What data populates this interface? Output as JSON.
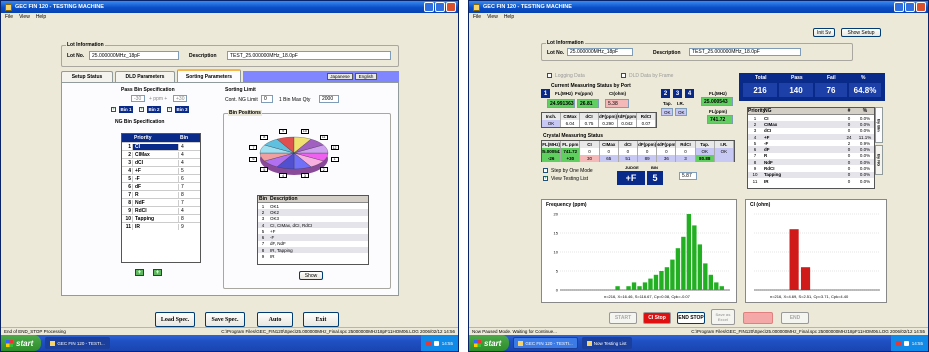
{
  "left": {
    "title": "GEC FIN 120 - TESTING MACHINE",
    "menu": [
      "File",
      "View",
      "Help"
    ],
    "lot": {
      "group_title": "Lot Information",
      "lotno_label": "Lot No.",
      "lotno_value": "25.000000MHz_18pF",
      "desc_label": "Description",
      "desc_value": "TEST_25.000000MHz_18.0pF"
    },
    "tabs": [
      "Setup Status",
      "DLD Parameters",
      "Sorting Parameters"
    ],
    "lang": [
      "Japanese",
      "English"
    ],
    "pass_bin": {
      "title": "Pass Bin Specification",
      "minus": "-30",
      "unit": "+ ppm +",
      "plus": "+30",
      "bins": [
        "Bin 1",
        "Bin 2",
        "Bin 3"
      ]
    },
    "ng_bin": {
      "title": "NG Bin Specification",
      "headers": [
        "Priority",
        "Bin"
      ],
      "rows": [
        [
          "1",
          "CI",
          "4"
        ],
        [
          "2",
          "CIMax",
          "4"
        ],
        [
          "3",
          "dCI",
          "4"
        ],
        [
          "4",
          "+F",
          "5"
        ],
        [
          "5",
          "-F",
          "6"
        ],
        [
          "6",
          "dF",
          "7"
        ],
        [
          "7",
          "R",
          "8"
        ],
        [
          "8",
          "NdF",
          "7"
        ],
        [
          "9",
          "RdCI",
          "4"
        ],
        [
          "10",
          "Tapping",
          "8"
        ],
        [
          "11",
          "IR",
          "9"
        ]
      ]
    },
    "sorting_limit": {
      "title": "Sorting Limit",
      "cont_label": "Cont. NG Limit",
      "cont_value": "0",
      "bin_label": "1 Bin Max Qty",
      "bin_value": "2000"
    },
    "bin_positions": {
      "title": "Bin Positions",
      "pie_labels": [
        "1",
        "2",
        "3",
        "4",
        "5",
        "6",
        "7",
        "8",
        "9",
        "10",
        "11",
        "12"
      ],
      "desc_headers": [
        "Bin",
        "Description"
      ],
      "desc_rows": [
        [
          "1",
          "OK1"
        ],
        [
          "2",
          "OK2"
        ],
        [
          "3",
          "OK3"
        ],
        [
          "4",
          "CI, CIMax, dCI, RdCI"
        ],
        [
          "5",
          "+F"
        ],
        [
          "6",
          "-F"
        ],
        [
          "7",
          "dF, NdF"
        ],
        [
          "8",
          "IR, Tapping"
        ],
        [
          "9",
          "IR"
        ]
      ],
      "show_btn": "Show"
    },
    "footer_buttons": [
      "Load Spec.",
      "Save Spec.",
      "Auto",
      "Exit"
    ],
    "status_left": "End of END_STOP Processing",
    "status_right": "C:\\Program Files\\GEC_FIN120\\Spec\\25.000000MHz_Final.spc  25000000MHz18pF11HOM06.LOG  2006/02/12  14:56",
    "task_item": "GEC FIN 120 - TESTI..."
  },
  "right": {
    "title": "GEC FIN 120 - TESTING MACHINE",
    "menu": [
      "File",
      "View",
      "Help"
    ],
    "top_buttons": [
      "Init Sv",
      "Show Setup"
    ],
    "lot": {
      "group_title": "Lot Information",
      "lotno_label": "Lot No.",
      "lotno_value": "25.000000MHz_18pF",
      "desc_label": "Description",
      "desc_value": "TEST_25.000000MHz_18.0pF"
    },
    "options": [
      "Logging Data",
      "DLD Data by Frame"
    ],
    "current": {
      "title": "Current Measuring Status by Port",
      "ports": [
        "1",
        "2",
        "3",
        "4"
      ],
      "h1": [
        "FL(MHz)",
        "Fs(ppm)",
        "CI(ohm)"
      ],
      "v1": [
        "24.991363",
        "26.81",
        "5.38"
      ],
      "h2": [
        "Inch.",
        "CIMax",
        "dCI",
        "dF(ppm)",
        "RdF(ppm)",
        "RdCI"
      ],
      "v2": [
        "OK",
        "6.04",
        "0.75",
        "0.290",
        "0.042",
        "0.07"
      ],
      "tap_label": "Tap.",
      "ir_label": "I.R.",
      "tap_value": "OK",
      "ir_value": "OK",
      "fl_label": "FL(MHz)",
      "fl_value": "25.000543",
      "fl2_label": "FL(ppm)",
      "fl2_value": "741.72"
    },
    "crystal": {
      "title": "Crystal Measuring Status",
      "headers": [
        "FL(MHz)",
        "FL ppm",
        "CI",
        "CIMax",
        "dCI",
        "dF(ppm)",
        "NdF(ppm)",
        "RdCI",
        "Tap.",
        "I.R."
      ],
      "values": [
        "25.000543",
        "741.72",
        "0",
        "0",
        "0",
        "0",
        "0",
        "0",
        "OK",
        "OK"
      ],
      "values2": [
        "-26",
        "+30",
        "30",
        "65",
        "51",
        "89",
        "36",
        "3",
        "80.88",
        ""
      ],
      "opt1": "Step by One Mode",
      "opt2": "View Testing List",
      "judge_label": "JUDGE",
      "judge_value": "+F",
      "bin_label": "BIN",
      "bin_value": "5",
      "small_value": "5.87"
    },
    "stats": {
      "headers": [
        "Total",
        "Pass",
        "Fail",
        "%"
      ],
      "values": [
        "216",
        "140",
        "76",
        "64.8%"
      ]
    },
    "fail_table": {
      "headers": [
        "Priority",
        "NG",
        "#",
        "%"
      ],
      "rows": [
        [
          "1",
          "CI",
          "0",
          "0.0%"
        ],
        [
          "2",
          "CIMax",
          "0",
          "0.0%"
        ],
        [
          "3",
          "dCI",
          "0",
          "0.0%"
        ],
        [
          "4",
          "+F",
          "24",
          "11.1%"
        ],
        [
          "5",
          "-F",
          "2",
          "0.9%"
        ],
        [
          "6",
          "dF",
          "0",
          "0.0%"
        ],
        [
          "7",
          "R",
          "0",
          "0.0%"
        ],
        [
          "8",
          "NdF",
          "0",
          "0.0%"
        ],
        [
          "9",
          "RdCI",
          "0",
          "0.0%"
        ],
        [
          "10",
          "Tapping",
          "0",
          "0.0%"
        ],
        [
          "11",
          "IR",
          "0",
          "0.0%"
        ]
      ],
      "sidetabs": [
        "By Bin",
        "By NG"
      ]
    },
    "freq_chart": {
      "title": "Frequency (ppm)",
      "yticks": [
        "20",
        "15",
        "10",
        "5",
        "0"
      ],
      "caption": "n=216, X=16.46, S=116.67, Cp=0.08, Cpk=-0.07"
    },
    "ci_chart": {
      "title": "CI (ohm)",
      "caption": "n=216, X=4.69, S=2.51, Cp=3.71, Cpk=4.40"
    },
    "ctrl_buttons": [
      "START",
      "CI Stop",
      "END STOP",
      "Save as Excel",
      "",
      "END"
    ],
    "status_left": "Now Paused Mode. Waiting for Continue...",
    "status_right": "C:\\Program Files\\GEC_FIN120\\Spec\\25.000000MHz_Final.spc  25000000MHz18pF11HOM06.LOG  2006/02/12  14:55",
    "task_item1": "GEC FIN 120 - TESTI...",
    "task_item2": "Now Testing List"
  },
  "taskbar": {
    "start": "start",
    "clock": "14:55"
  },
  "colors": {
    "navy": "#0a2a8a",
    "title_blue": "#0a4ec8",
    "bar_green": "#22b022",
    "bar_red": "#d01a1a"
  },
  "chart_data": [
    {
      "type": "bar",
      "title": "Frequency (ppm)",
      "x": [
        -30,
        -28,
        -26,
        -24,
        -22,
        -20,
        -18,
        -16,
        -14,
        -12,
        -10,
        -8,
        -6,
        -4,
        -2,
        0,
        2,
        4,
        6,
        8,
        10,
        12,
        14,
        16,
        18,
        20,
        22,
        24,
        26,
        28,
        30
      ],
      "values": [
        0,
        0,
        0,
        0,
        0,
        0,
        0,
        0,
        0,
        0,
        1,
        0,
        1,
        2,
        1,
        2,
        3,
        4,
        5,
        6,
        8,
        11,
        14,
        20,
        17,
        12,
        7,
        4,
        2,
        1,
        0
      ],
      "ylim": [
        0,
        20
      ],
      "legend": "none"
    },
    {
      "type": "bar",
      "title": "CI (ohm)",
      "x": [
        0,
        1,
        2,
        3,
        4,
        5,
        6,
        7,
        8,
        9,
        10
      ],
      "values": [
        0,
        0,
        0,
        8,
        3,
        0,
        0,
        0,
        0,
        0,
        0
      ],
      "ylim": [
        0,
        10
      ],
      "legend": "none"
    }
  ]
}
